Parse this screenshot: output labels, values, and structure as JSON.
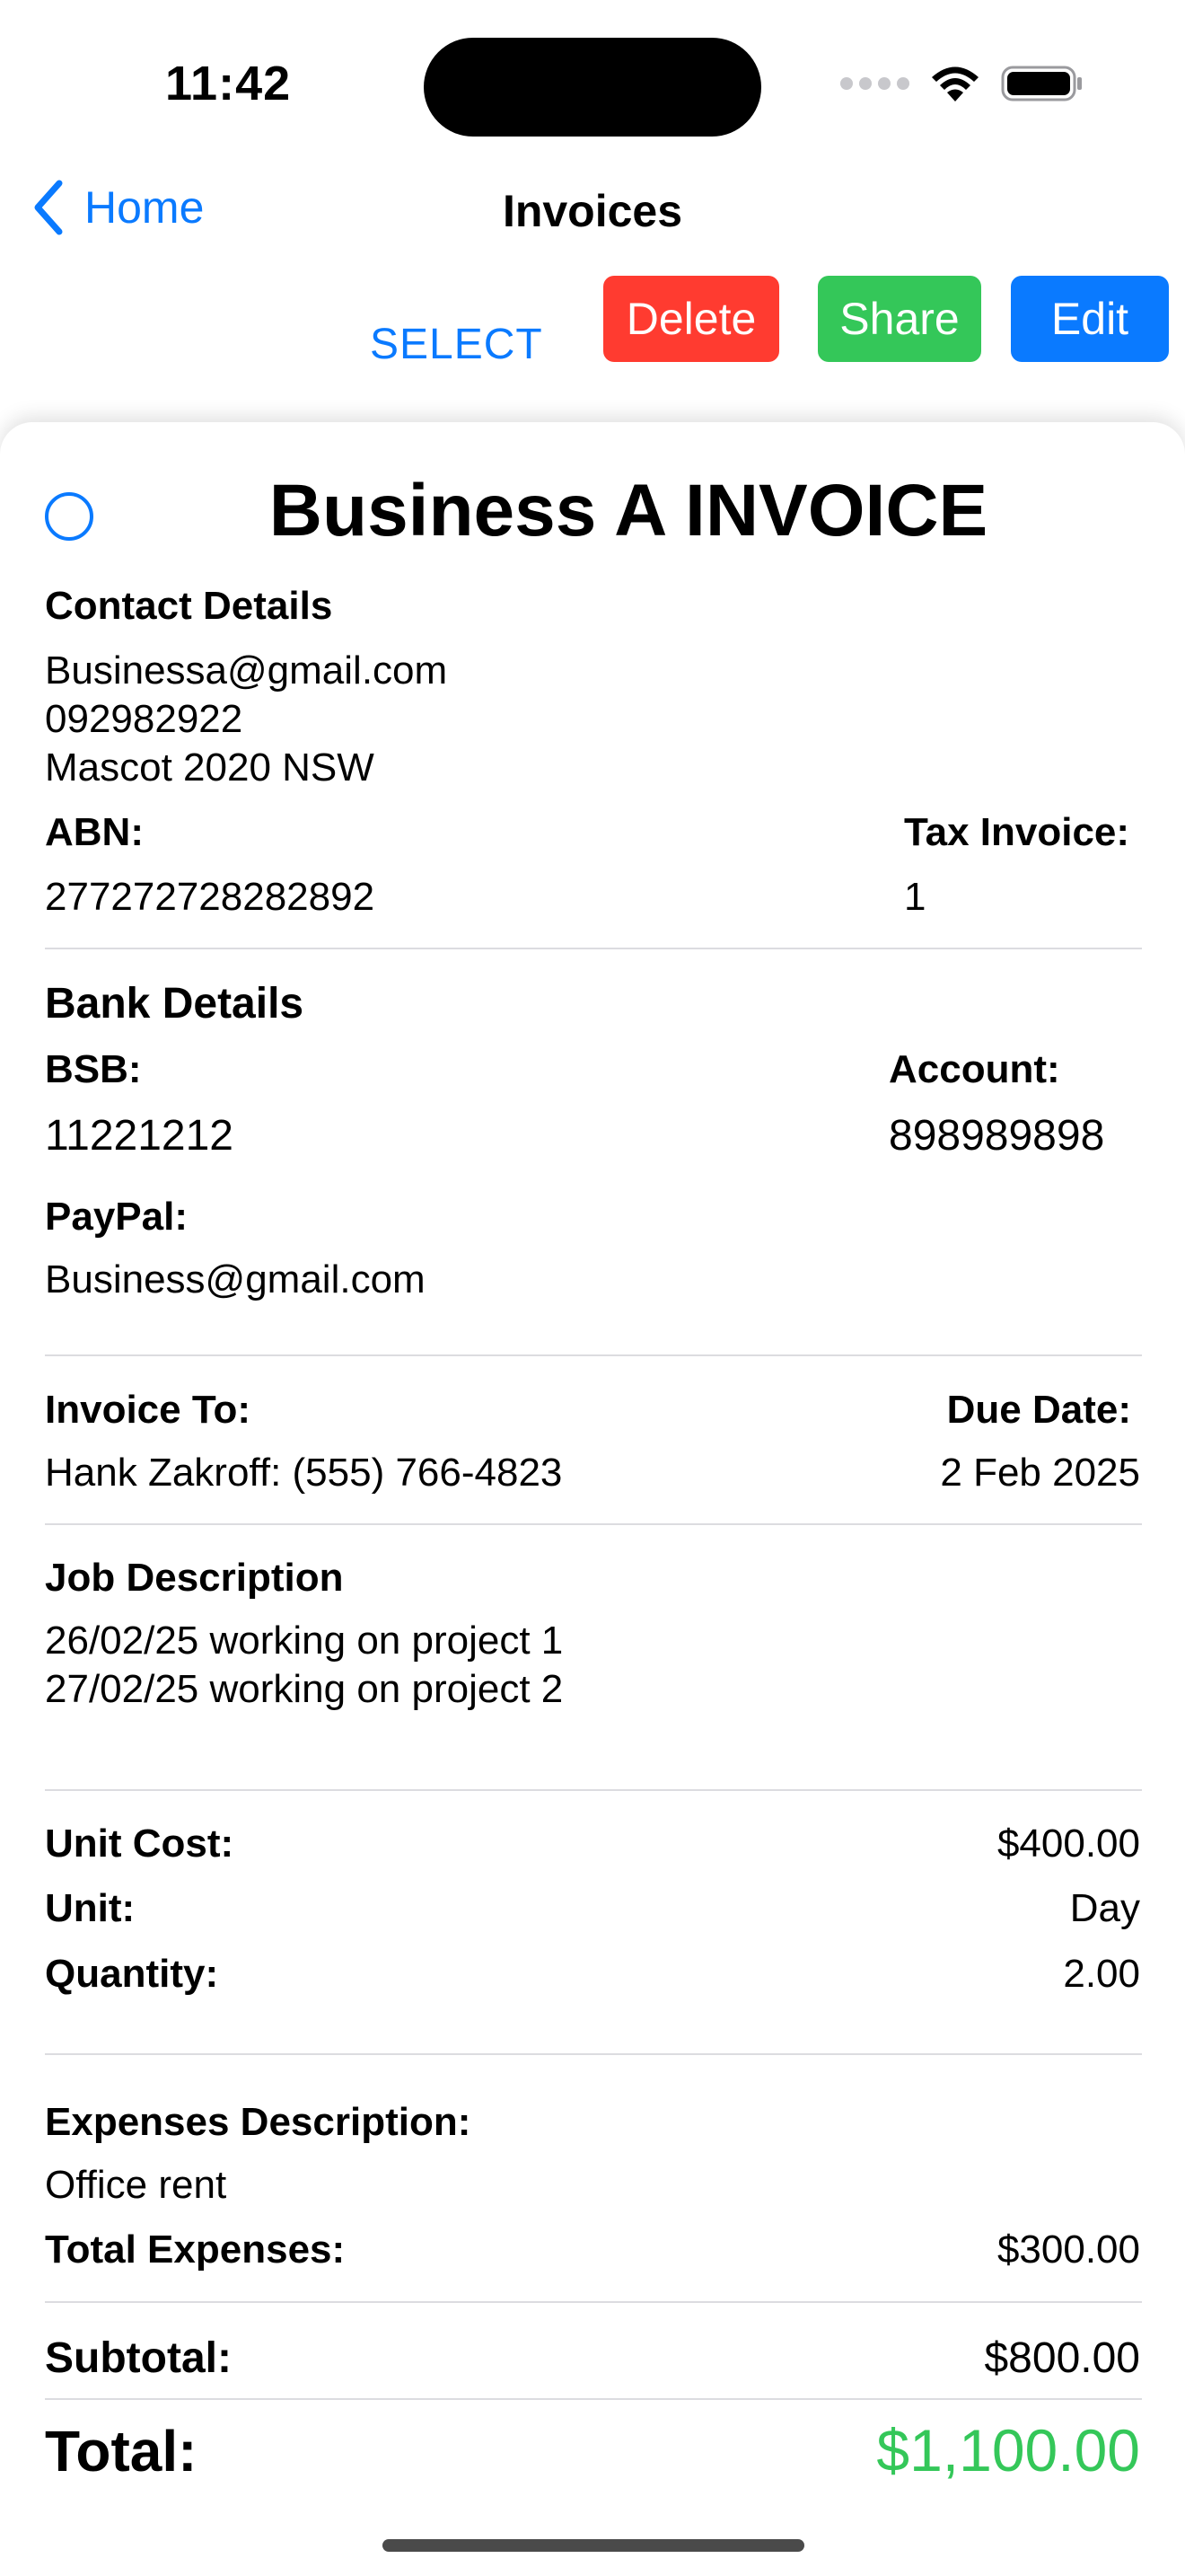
{
  "status_bar": {
    "time": "11:42",
    "icons": [
      "cellular-dots-icon",
      "wifi-icon",
      "battery-icon"
    ]
  },
  "nav": {
    "back_label": "Home",
    "back_icon": "chevron-left-icon",
    "title": "Invoices"
  },
  "toolbar": {
    "select_label": "SELECT",
    "delete_label": "Delete",
    "share_label": "Share",
    "edit_label": "Edit"
  },
  "colors": {
    "accent": "#0a7aff",
    "delete": "#ff3b30",
    "share": "#34c759",
    "edit": "#0a7aff",
    "total": "#34c759"
  },
  "invoice": {
    "title": "Business A INVOICE",
    "contact": {
      "heading": "Contact Details",
      "email": "Businessa@gmail.com",
      "phone": "092982922",
      "address": "Mascot 2020 NSW"
    },
    "abn": {
      "label": "ABN:",
      "value": "277272728282892"
    },
    "tax_invoice": {
      "label": "Tax Invoice:",
      "value": "1"
    },
    "bank": {
      "heading": "Bank Details",
      "bsb_label": "BSB:",
      "bsb_value": "11221212",
      "account_label": "Account:",
      "account_value": "898989898",
      "paypal_label": "PayPal:",
      "paypal_value": "Business@gmail.com"
    },
    "invoice_to": {
      "label": "Invoice To:",
      "value": "Hank Zakroff: (555) 766-4823"
    },
    "due_date": {
      "label": "Due Date:",
      "value": "2 Feb 2025"
    },
    "job": {
      "heading": "Job Description",
      "lines": [
        "26/02/25 working on project 1",
        "27/02/25 working on project 2"
      ]
    },
    "unit_cost": {
      "label": "Unit Cost:",
      "value": "$400.00"
    },
    "unit": {
      "label": "Unit:",
      "value": "Day"
    },
    "quantity": {
      "label": "Quantity:",
      "value": "2.00"
    },
    "expenses": {
      "heading": "Expenses Description:",
      "description": "Office rent",
      "total_label": "Total Expenses:",
      "total_value": "$300.00"
    },
    "subtotal": {
      "label": "Subtotal:",
      "value": "$800.00"
    },
    "total": {
      "label": "Total:",
      "value": "$1,100.00"
    }
  }
}
